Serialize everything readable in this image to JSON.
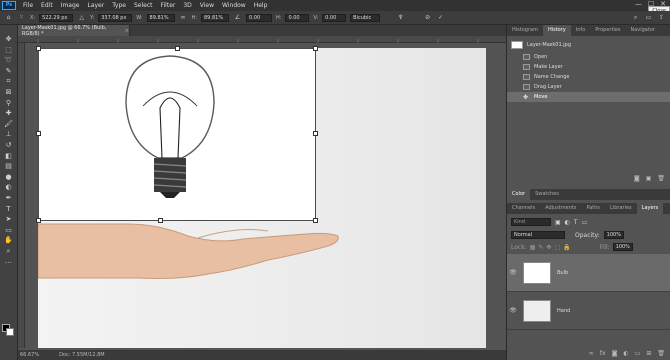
{
  "menu": {
    "logo": "Ps",
    "items": [
      "File",
      "Edit",
      "Image",
      "Layer",
      "Type",
      "Select",
      "Filter",
      "3D",
      "View",
      "Window",
      "Help"
    ],
    "tooltip": "Close"
  },
  "options": {
    "x_label": "X:",
    "x_value": "522.29 px",
    "y_label": "Y:",
    "y_value": "337.08 px",
    "w_label": "W:",
    "w_value": "89.81%",
    "h_label": "H:",
    "h_value": "89.81%",
    "angle_value": "0.00",
    "hskew_label": "H:",
    "hskew_value": "0.00",
    "vskew_label": "V:",
    "vskew_value": "0.00",
    "interp_value": "Bicubic"
  },
  "document": {
    "tab_title": "Layer-Mask01.jpg @ 66.7% (Bulb, RGB/8) *"
  },
  "status": {
    "zoom": "66.67%",
    "doc_info": "Doc: 7.55M/12.8M"
  },
  "history": {
    "tabs": [
      "Histogram",
      "History",
      "Info",
      "Properties",
      "Navigator"
    ],
    "active_tab": "History",
    "snapshot": "Layer-Mask01.jpg",
    "items": [
      "Open",
      "Make Layer",
      "Name Change",
      "Drag Layer",
      "Move"
    ],
    "selected_index": 4
  },
  "color_panel": {
    "tabs": [
      "Color",
      "Swatches"
    ],
    "active_tab": "Color"
  },
  "layers_panel": {
    "tabs": [
      "Channels",
      "Adjustments",
      "Paths",
      "Libraries",
      "Layers"
    ],
    "active_tab": "Layers",
    "search_placeholder": "Kind",
    "blend_mode": "Normal",
    "opacity_label": "Opacity:",
    "opacity_value": "100%",
    "lock_label": "Lock:",
    "fill_label": "Fill:",
    "fill_value": "100%",
    "layers": [
      {
        "name": "Bulb"
      },
      {
        "name": "Hand"
      }
    ]
  },
  "colors": {
    "accent": "#31a8ff",
    "panel_bg": "#535353",
    "dark_bar": "#323232"
  }
}
